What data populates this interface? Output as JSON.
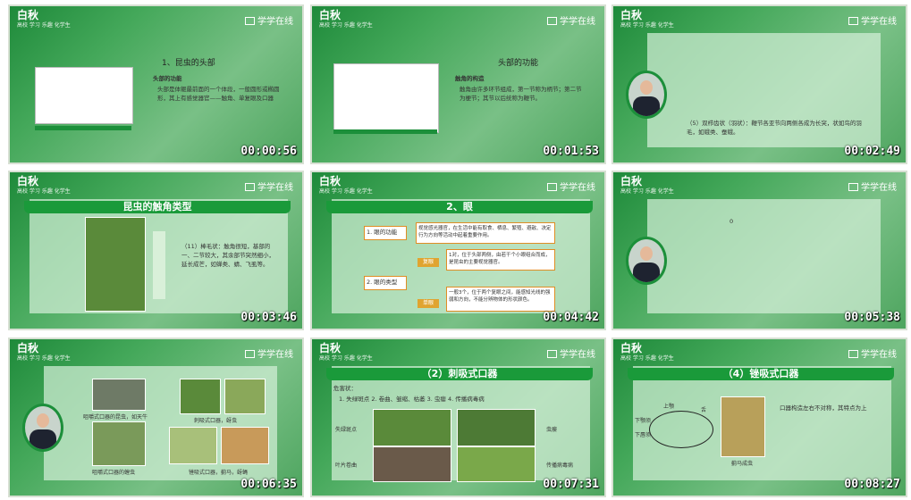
{
  "logo": {
    "mark": "白秋",
    "sub": "高校 学习 乐趣 化学生"
  },
  "brand": "学学在线",
  "thumbnails": [
    {
      "time": "00:00:56",
      "title": "1、昆虫的头部",
      "heading": "头部的功能",
      "text": "头部是体躯最前面的一个体段，一般圆形或椭圆形，其上有感觉器官——触角、单复眼及口器"
    },
    {
      "time": "00:01:53",
      "title": "头部的功能",
      "heading": "触角的构造",
      "text": "触角由许多环节组成，第一节称为柄节；第二节为梗节；其节以后统称为鞭节。"
    },
    {
      "time": "00:02:49",
      "text": "（5）双栉齿状（羽状）：鞭节各亚节向两侧各成为长突，状如鸟的羽毛，如蛾类、蚕蛾。"
    },
    {
      "time": "00:03:46",
      "title": "昆虫的触角类型",
      "text": "（11）棒毛状：触角很短，基部的一、二节较大，其余部节突然细小，延长成芒，如蝉类、蜻、飞虱等。"
    },
    {
      "time": "00:04:42",
      "title": "2、眼",
      "b1": "1. 眼的功能",
      "b1text": "视觉感光器官，在生活中能有取食、栖息、繁殖、避敌、决定行为方向等活动中起着重要作用。",
      "b2": "2. 眼的类型",
      "tag1": "复眼",
      "tag1text": "1对，位于头部两侧，由若干个小眼组合而成，是昆虫的主要视觉器官。",
      "tag2": "单眼",
      "tag2text": "一般3个，位于两个复眼之间，能感知光线的强弱和方向，不能分辨物体的形状颜色。"
    },
    {
      "time": "00:05:38",
      "text": "0"
    },
    {
      "time": "00:06:35",
      "captions": [
        "咀嚼式口器的昆虫，如天牛",
        "刺吸式口器，蚜虫",
        "咀嚼式口器的蝗虫",
        "锉吸式口器，蓟马，蚜蝇"
      ]
    },
    {
      "time": "00:07:31",
      "title": "（2）刺吸式口器",
      "header": "危害状：",
      "list": "1. 失绿斑点  2. 卷曲、皱缩、枯萎  3. 虫瘿  4. 传播病毒病",
      "left1": "失绿斑点",
      "left2": "叶片卷曲",
      "right1": "虫瘿",
      "right2": "传播病毒病"
    },
    {
      "time": "00:08:27",
      "title": "（4）锉吸式口器",
      "text": "口器构造左右不对称，其特点为上",
      "caption": "蓟马成虫",
      "labels": [
        "上颚",
        "下颚须",
        "下唇须",
        "舌"
      ]
    }
  ]
}
